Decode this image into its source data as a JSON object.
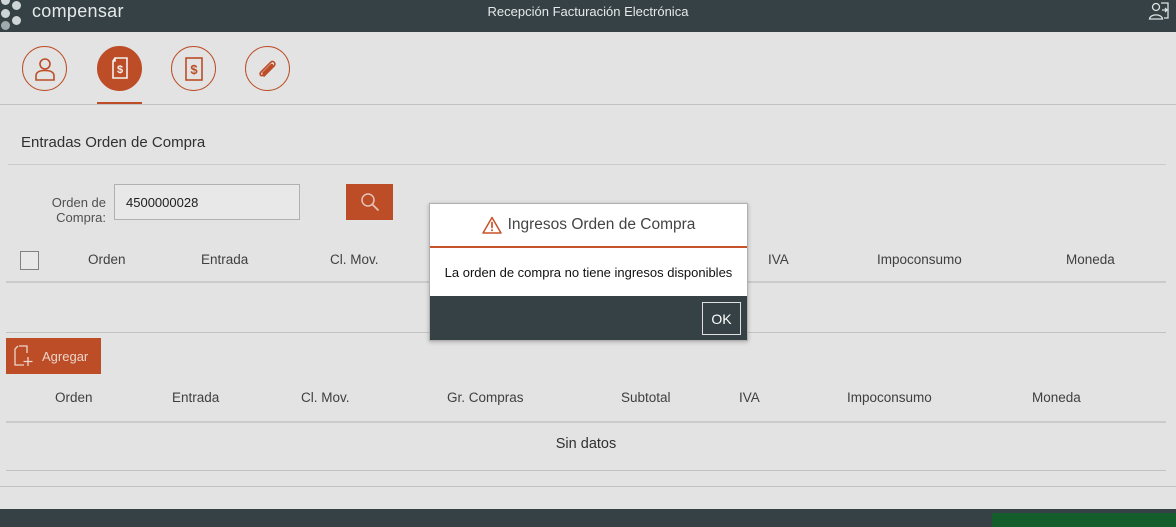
{
  "header": {
    "brand": "compensar",
    "title": "Recepción Facturación Electrónica",
    "exit_icon": "user-exit-icon"
  },
  "steps": [
    {
      "icon": "user-icon",
      "active": false
    },
    {
      "icon": "invoice-icon",
      "active": true
    },
    {
      "icon": "money-icon",
      "active": false
    },
    {
      "icon": "paperclip-icon",
      "active": false
    }
  ],
  "section": {
    "title": "Entradas Orden de Compra"
  },
  "search": {
    "label_line1": "Orden de",
    "label_line2": "Compra:",
    "value": "4500000028",
    "button_icon": "search-icon"
  },
  "entries_table": {
    "columns": [
      "Orden",
      "Entrada",
      "Cl. Mov.",
      "IVA",
      "Impoconsumo",
      "Moneda"
    ]
  },
  "add_button": {
    "label": "Agregar",
    "icon": "add-document-icon"
  },
  "selected_table": {
    "columns": [
      "Orden",
      "Entrada",
      "Cl. Mov.",
      "Gr. Compras",
      "Subtotal",
      "IVA",
      "Impoconsumo",
      "Moneda"
    ],
    "empty_text": "Sin datos"
  },
  "dialog": {
    "title": "Ingresos Orden de Compra",
    "message": "La orden de compra no tiene ingresos disponibles",
    "ok_label": "OK",
    "icon": "warning-icon"
  },
  "colors": {
    "accent": "#c8522a",
    "header_bg": "#354145",
    "footer_green": "#135e2b"
  }
}
